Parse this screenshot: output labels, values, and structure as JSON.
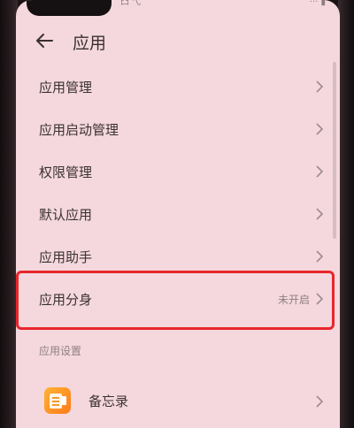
{
  "status_bar": {
    "left_text": "凸 弋",
    "right_text": "··· ▮"
  },
  "header": {
    "title": "应用"
  },
  "menu": {
    "items": [
      {
        "label": "应用管理",
        "value": ""
      },
      {
        "label": "应用启动管理",
        "value": ""
      },
      {
        "label": "权限管理",
        "value": ""
      },
      {
        "label": "默认应用",
        "value": ""
      },
      {
        "label": "应用助手",
        "value": ""
      },
      {
        "label": "应用分身",
        "value": "未开启"
      }
    ]
  },
  "section": {
    "header": "应用设置"
  },
  "apps": [
    {
      "label": "备忘录",
      "icon": "notepad-icon"
    }
  ],
  "colors": {
    "screen_bg": "#f4d8de",
    "highlight": "#e8262b",
    "text_primary": "#3b3133",
    "text_secondary": "#8f7f83"
  }
}
